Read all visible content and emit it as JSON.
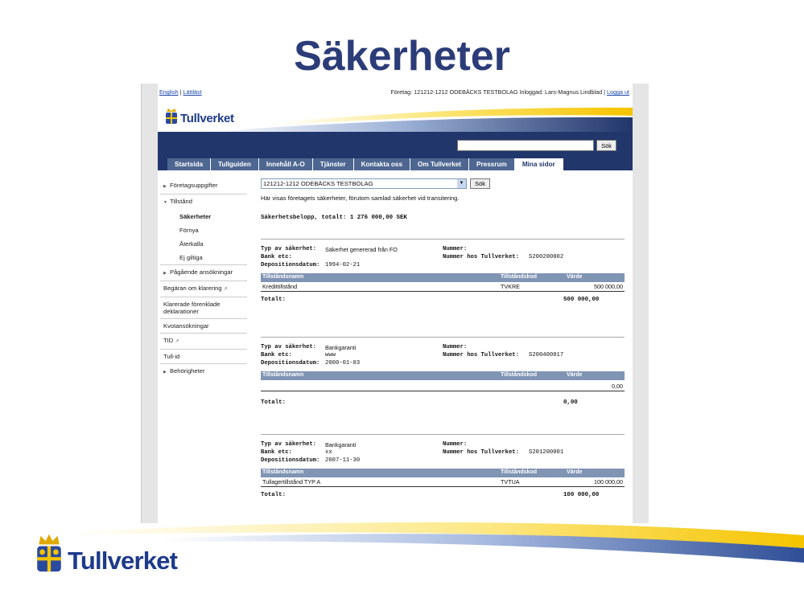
{
  "slide": {
    "title": "Säkerheter",
    "brand": "Tullverket"
  },
  "topbar": {
    "link_english": "English",
    "sep": "|",
    "link_lattlast": "Lättläst",
    "company": "Företag: 121212-1212 ODEBÄCKS TESTBOLAG Inloggad: Lars-Magnus Lindblad |",
    "logout": "Logga ut"
  },
  "header": {
    "brand": "Tullverket"
  },
  "search": {
    "button": "Sök",
    "value": ""
  },
  "tabs": [
    {
      "label": "Startsida"
    },
    {
      "label": "Tullguiden"
    },
    {
      "label": "Innehåll A-O"
    },
    {
      "label": "Tjänster"
    },
    {
      "label": "Kontakta oss"
    },
    {
      "label": "Om Tullverket"
    },
    {
      "label": "Pressrum"
    },
    {
      "label": "Mina sidor"
    }
  ],
  "sidebar": {
    "items": [
      {
        "label": "Företagsuppgifter"
      },
      {
        "label": "Tillstånd"
      },
      {
        "label": "Säkerheter"
      },
      {
        "label": "Förnya"
      },
      {
        "label": "Återkalla"
      },
      {
        "label": "Ej giltiga"
      },
      {
        "label": "Pågående ansökningar"
      },
      {
        "label": "Begäran om klarering"
      },
      {
        "label": "Klarerade förenklade deklarationer"
      },
      {
        "label": "Kvotansökningar"
      },
      {
        "label": "TID"
      },
      {
        "label": "Tull-id"
      },
      {
        "label": "Behörigheter"
      }
    ]
  },
  "main": {
    "company_select": "121212-1212 ODEBÄCKS TESTBOLAG",
    "search_button": "Sök",
    "intro": "Här visas företagets säkerheter, förutom samlad säkerhet vid transitering.",
    "total_amount": "Säkerhetsbelopp, totalt: 1 276 000,00 SEK",
    "labels": {
      "type": "Typ av säkerhet:",
      "bank": "Bank etc:",
      "date": "Depositionsdatum:",
      "number": "Nummer:",
      "number_tv": "Nummer hos Tullverket:",
      "col_name": "Tillståndsnamn",
      "col_code": "Tillståndskod",
      "col_value": "Värde",
      "total": "Totalt:"
    },
    "blocks": [
      {
        "type": "Säkerhet genererad från FO",
        "bank": "",
        "date": "1994-02-21",
        "number": "",
        "number_tv": "S200200002",
        "row_name": "Kredittillstånd",
        "row_code": "TVKRE",
        "row_value": "500 000,00",
        "total": "500 000,00"
      },
      {
        "type": "Bankgaranti",
        "bank": "www",
        "date": "2000-01-03",
        "number": "",
        "number_tv": "S200400017",
        "row_name": "",
        "row_code": "",
        "row_value": "0,00",
        "total": "0,00"
      },
      {
        "type": "Bankgaranti",
        "bank": "xx",
        "date": "2007-11-30",
        "number": "",
        "number_tv": "S201200001",
        "row_name": "Tullagertillstånd TYP A",
        "row_code": "TVTUA",
        "row_value": "100 000,00",
        "total": "100 000,00"
      }
    ]
  }
}
